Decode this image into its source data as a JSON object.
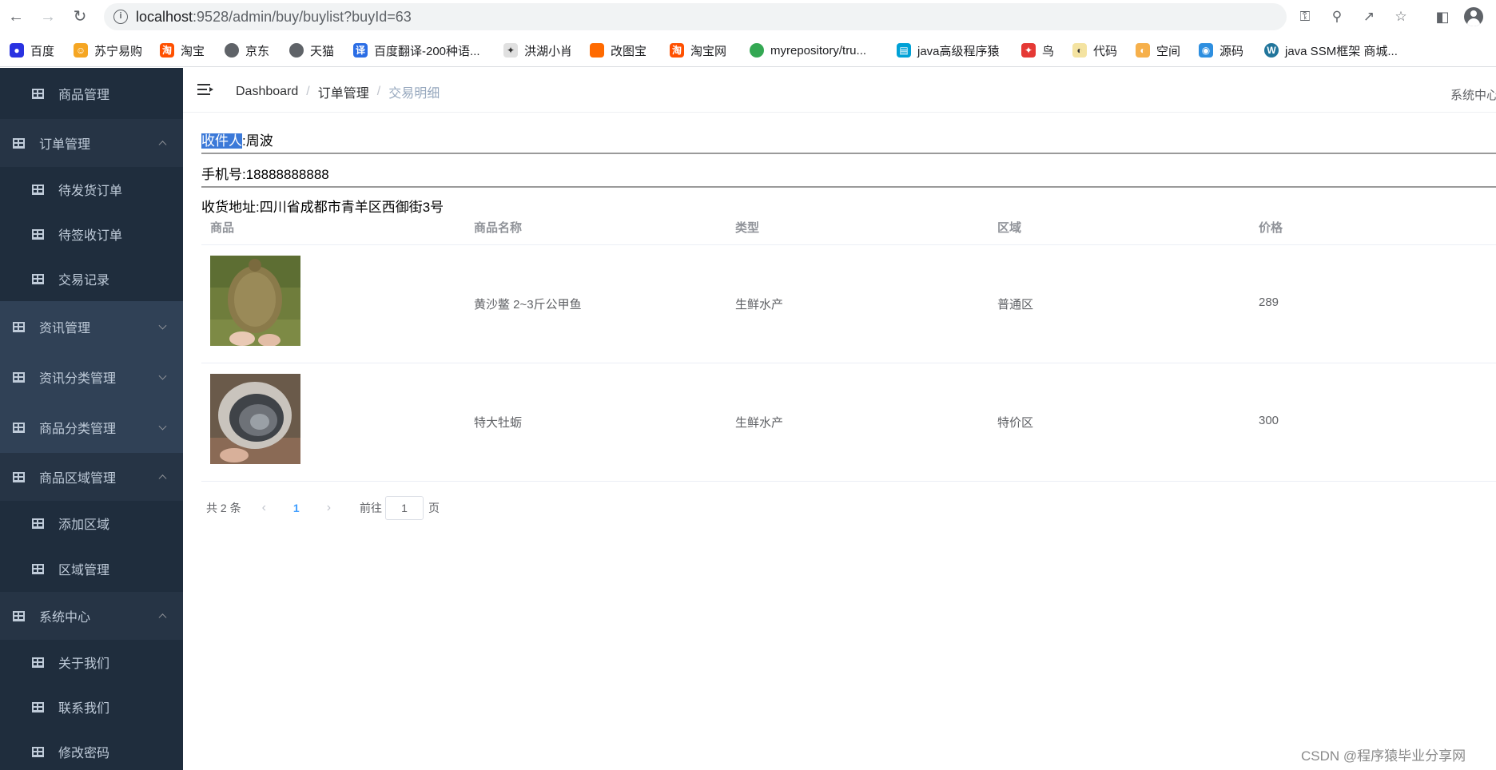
{
  "browser": {
    "url_host": "localhost",
    "url_rest": ":9528/admin/buy/buylist?buyId=63",
    "bookmarks": [
      "百度",
      "苏宁易购",
      "淘宝",
      "京东",
      "天猫",
      "百度翻译-200种语...",
      "洪湖小肖",
      "改图宝",
      "淘宝网",
      "myrepository/tru...",
      "java高级程序猿",
      "鸟",
      "代码",
      "空间",
      "源码",
      "java SSM框架 商城..."
    ]
  },
  "sidebar": {
    "items": [
      {
        "label": "商品管理"
      },
      {
        "label": "订单管理"
      },
      {
        "label": "待发货订单"
      },
      {
        "label": "待签收订单"
      },
      {
        "label": "交易记录"
      },
      {
        "label": "资讯管理"
      },
      {
        "label": "资讯分类管理"
      },
      {
        "label": "商品分类管理"
      },
      {
        "label": "商品区域管理"
      },
      {
        "label": "添加区域"
      },
      {
        "label": "区域管理"
      },
      {
        "label": "系统中心"
      },
      {
        "label": "关于我们"
      },
      {
        "label": "联系我们"
      },
      {
        "label": "修改密码"
      }
    ]
  },
  "navbar": {
    "breadcrumbs": [
      "Dashboard",
      "订单管理",
      "交易明细"
    ],
    "sys_link": "系统中心"
  },
  "order": {
    "receiver_label": "收件人",
    "receiver_value": ":周波",
    "phone": "手机号:18888888888",
    "address": "收货地址:四川省成都市青羊区西御街3号"
  },
  "table": {
    "headers": [
      "商品",
      "商品名称",
      "类型",
      "区域",
      "价格"
    ],
    "rows": [
      {
        "name": "黄沙鳖 2~3斤公甲鱼",
        "type": "生鲜水产",
        "region": "普通区",
        "price": "289"
      },
      {
        "name": "特大牡蛎",
        "type": "生鲜水产",
        "region": "特价区",
        "price": "300"
      }
    ]
  },
  "pager": {
    "total": "共 2 条",
    "current": "1",
    "goto_label": "前往",
    "goto_value": "1",
    "page_suffix": "页"
  },
  "watermark": "CSDN @程序猿毕业分享网"
}
